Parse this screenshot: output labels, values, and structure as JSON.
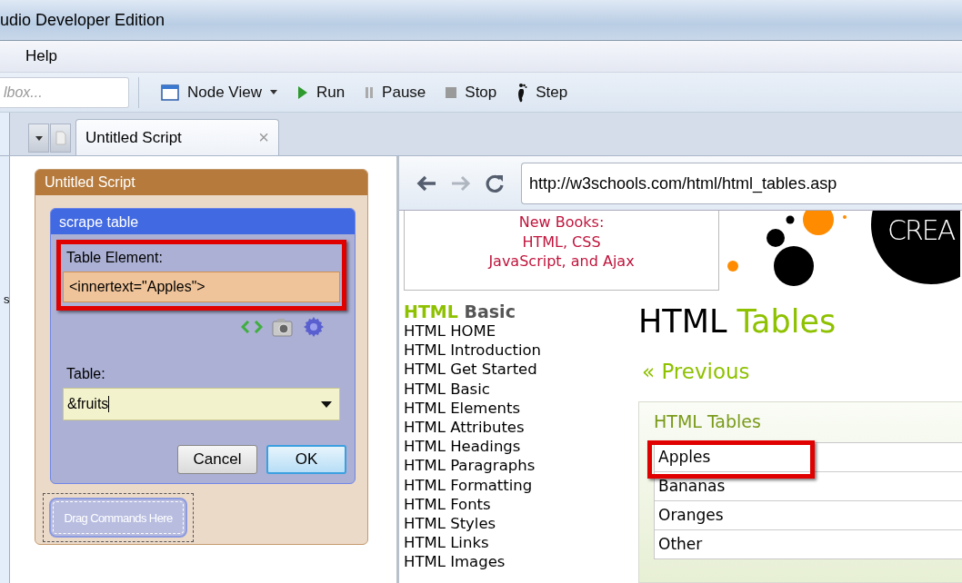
{
  "window": {
    "title": "udio Developer Edition"
  },
  "menu": [
    "Help"
  ],
  "toolbar": {
    "search": {
      "placeholder": "lbox..."
    },
    "buttons": [
      {
        "kind": "nodeview",
        "label": "Node View",
        "dropdown": true
      },
      {
        "kind": "run",
        "label": "Run"
      },
      {
        "kind": "pause",
        "label": "Pause"
      },
      {
        "kind": "stop",
        "label": "Stop"
      },
      {
        "kind": "step",
        "label": "Step"
      }
    ]
  },
  "tabs": [
    {
      "label": "Untitled Script",
      "selected": true,
      "close": "×"
    }
  ],
  "left_edge_text": "s",
  "script": {
    "title": "Untitled Script",
    "command": {
      "title": "scrape table",
      "fields": [
        {
          "kind": "text",
          "label": "Table Element:",
          "value": "<innertext=\"Apples\">",
          "highlighted": true
        },
        {
          "kind": "combo",
          "label": "Table:",
          "value": "&fruits",
          "highlighted": false
        }
      ],
      "buttons": [
        {
          "label": "Cancel",
          "default": false
        },
        {
          "label": "OK",
          "default": true
        }
      ]
    },
    "drop_zone": "Drag Commands Here"
  },
  "browser": {
    "url": "http://w3schools.com/html/html_tables.asp",
    "ad": [
      "New Books:",
      "HTML, CSS",
      "JavaScript, and Ajax"
    ],
    "logo_text": "CREA",
    "sidebar": {
      "heading_accent": "HTML",
      "heading": "Basic",
      "items": [
        "HTML HOME",
        "HTML Introduction",
        "HTML Get Started",
        "HTML Basic",
        "HTML Elements",
        "HTML Attributes",
        "HTML Headings",
        "HTML Paragraphs",
        "HTML Formatting",
        "HTML Fonts",
        "HTML Styles",
        "HTML Links",
        "HTML Images"
      ]
    },
    "title": "HTML",
    "title_accent": "Tables",
    "previous": "« Previous",
    "example": {
      "title": "HTML Tables",
      "rows": [
        {
          "text": "Apples",
          "highlighted": true
        },
        {
          "text": "Bananas",
          "highlighted": false
        },
        {
          "text": "Oranges",
          "highlighted": false
        },
        {
          "text": "Other",
          "highlighted": false
        }
      ]
    }
  }
}
